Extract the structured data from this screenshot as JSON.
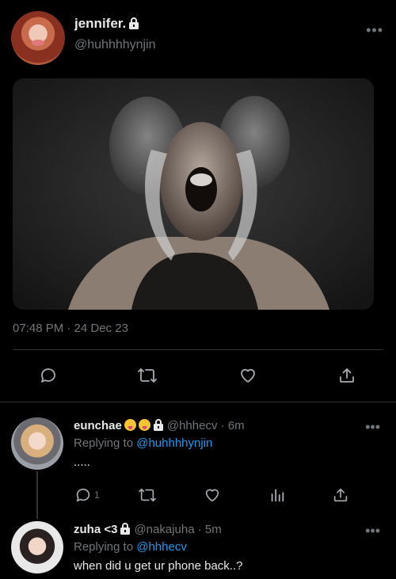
{
  "tweet": {
    "display_name": "jennifer.",
    "handle": "@huhhhhynjin",
    "timestamp": "07:48 PM · 24 Dec 23",
    "more_label": "•••"
  },
  "replies": [
    {
      "name": "eunchae",
      "meta": "@hhhecv · 6m",
      "replying_prefix": "Replying to ",
      "replying_to": "@huhhhhynjin",
      "text": ".....",
      "reply_count": "1",
      "more_label": "•••"
    },
    {
      "name": "zuha <3",
      "meta": "@nakajuha · 5m",
      "replying_prefix": "Replying to ",
      "replying_to": "@hhhecv",
      "text": "when did u get ur phone back..?",
      "more_label": "•••"
    }
  ],
  "icons": {
    "lock": "lock-icon",
    "reply": "reply-icon",
    "retweet": "retweet-icon",
    "like": "heart-icon",
    "share": "share-icon",
    "analytics": "analytics-icon"
  },
  "colors": {
    "background": "#000000",
    "text": "#e7e9ea",
    "secondary": "#71767b",
    "accent": "#1d9bf0",
    "divider": "#2f3336"
  }
}
